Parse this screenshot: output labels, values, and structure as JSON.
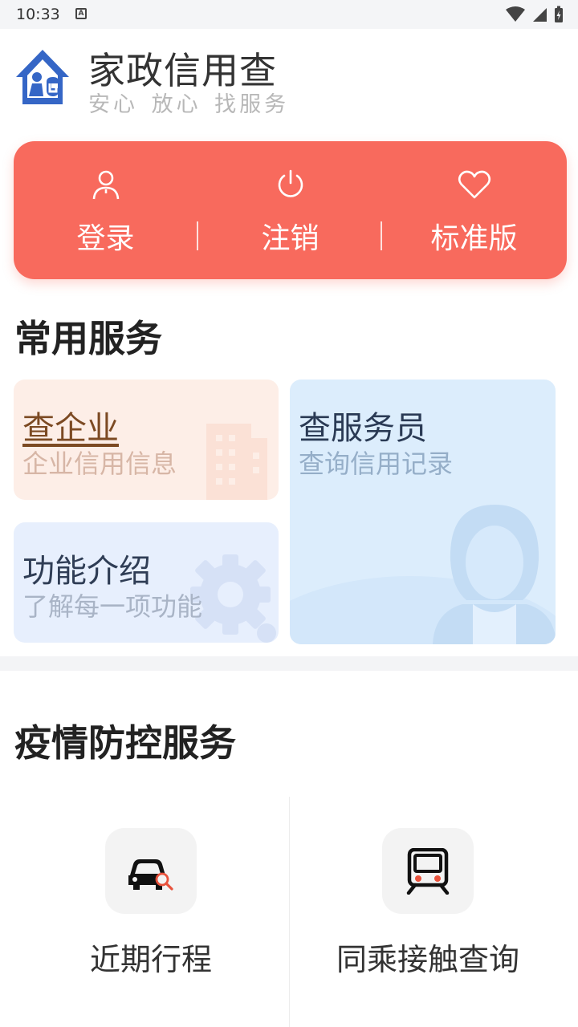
{
  "status_bar": {
    "time": "10:33"
  },
  "header": {
    "title": "家政信用查",
    "slogan": "安心 放心 找服务"
  },
  "actions": [
    {
      "label": "登录",
      "icon": "user-icon"
    },
    {
      "label": "注销",
      "icon": "power-icon"
    },
    {
      "label": "标准版",
      "icon": "heart-icon"
    }
  ],
  "common_services": {
    "title": "常用服务",
    "tiles": {
      "company": {
        "title": "查企业",
        "subtitle": "企业信用信息"
      },
      "intro": {
        "title": "功能介绍",
        "subtitle": "了解每一项功能"
      },
      "staff": {
        "title": "查服务员",
        "subtitle": "查询信用记录"
      }
    }
  },
  "epidemic_services": {
    "title": "疫情防控服务",
    "items": [
      {
        "label": "近期行程",
        "icon": "car-search-icon"
      },
      {
        "label": "同乘接触查询",
        "icon": "train-icon"
      }
    ]
  },
  "colors": {
    "accent": "#f86a5d",
    "logo_blue": "#3566c6"
  }
}
